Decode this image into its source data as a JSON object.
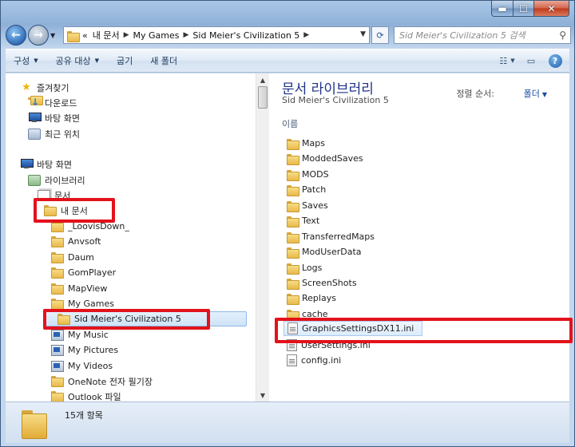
{
  "address": {
    "crumbs": [
      "«",
      "내 문서",
      "My Games",
      "Sid Meier's Civilization 5"
    ]
  },
  "search": {
    "placeholder": "Sid Meier's Civilization 5 검색"
  },
  "toolbar": {
    "organize": "구성",
    "share": "공유 대상",
    "burn": "굽기",
    "new_folder": "새 폴더"
  },
  "nav": {
    "favorites": "즐겨찾기",
    "downloads": "다운로드",
    "desktop_fav": "바탕 화면",
    "recent": "최근 위치",
    "desktop": "바탕 화면",
    "libraries": "라이브러리",
    "documents": "문서",
    "my_documents": "내 문서",
    "children": [
      "_LoovisDown_",
      "Anvsoft",
      "Daum",
      "GomPlayer",
      "MapView",
      "My Games"
    ],
    "civ": "Sid Meier's Civilization 5",
    "after": [
      "My Music",
      "My Pictures",
      "My Videos",
      "OneNote 전자 필기장",
      "Outlook 파일"
    ]
  },
  "content": {
    "library_title": "문서 라이브러리",
    "library_sub": "Sid Meier's Civilization 5",
    "sort_label": "정렬 순서:",
    "sort_value": "폴더",
    "column_name": "이름",
    "folders": [
      "Maps",
      "ModdedSaves",
      "MODS",
      "Patch",
      "Saves",
      "Text",
      "TransferredMaps",
      "ModUserData",
      "Logs",
      "ScreenShots",
      "Replays",
      "cache"
    ],
    "files": [
      "GraphicsSettingsDX11.ini",
      "UserSettings.ini",
      "config.ini"
    ]
  },
  "status": {
    "count": "15개 항목"
  },
  "colors": {
    "highlight": "#e3121b",
    "title": "#1e3287"
  }
}
